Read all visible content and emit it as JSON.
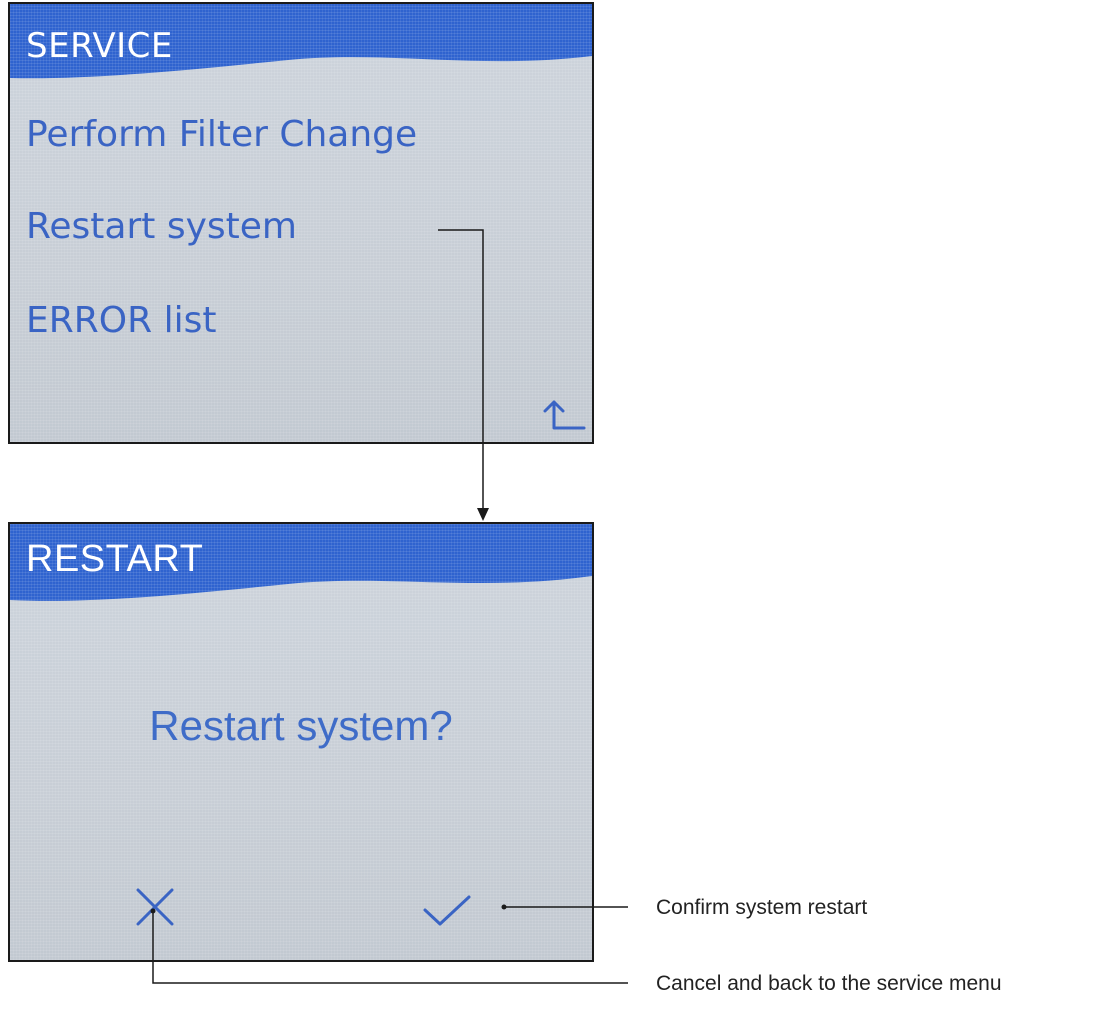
{
  "service_screen": {
    "title": "SERVICE",
    "menu_items": [
      {
        "label": "Perform Filter Change"
      },
      {
        "label": "Restart system"
      },
      {
        "label": "ERROR list"
      }
    ],
    "back_icon": "return-arrow-icon"
  },
  "restart_screen": {
    "title": "RESTART",
    "prompt": "Restart system?",
    "cancel_icon": "close-icon",
    "confirm_icon": "checkmark-icon"
  },
  "annotations": {
    "confirm": "Confirm system restart",
    "cancel": "Cancel and back to the service menu"
  },
  "colors": {
    "header_blue": "#2f63cf",
    "text_blue": "#3a64c4",
    "screen_bg": "#c9cfd7"
  }
}
